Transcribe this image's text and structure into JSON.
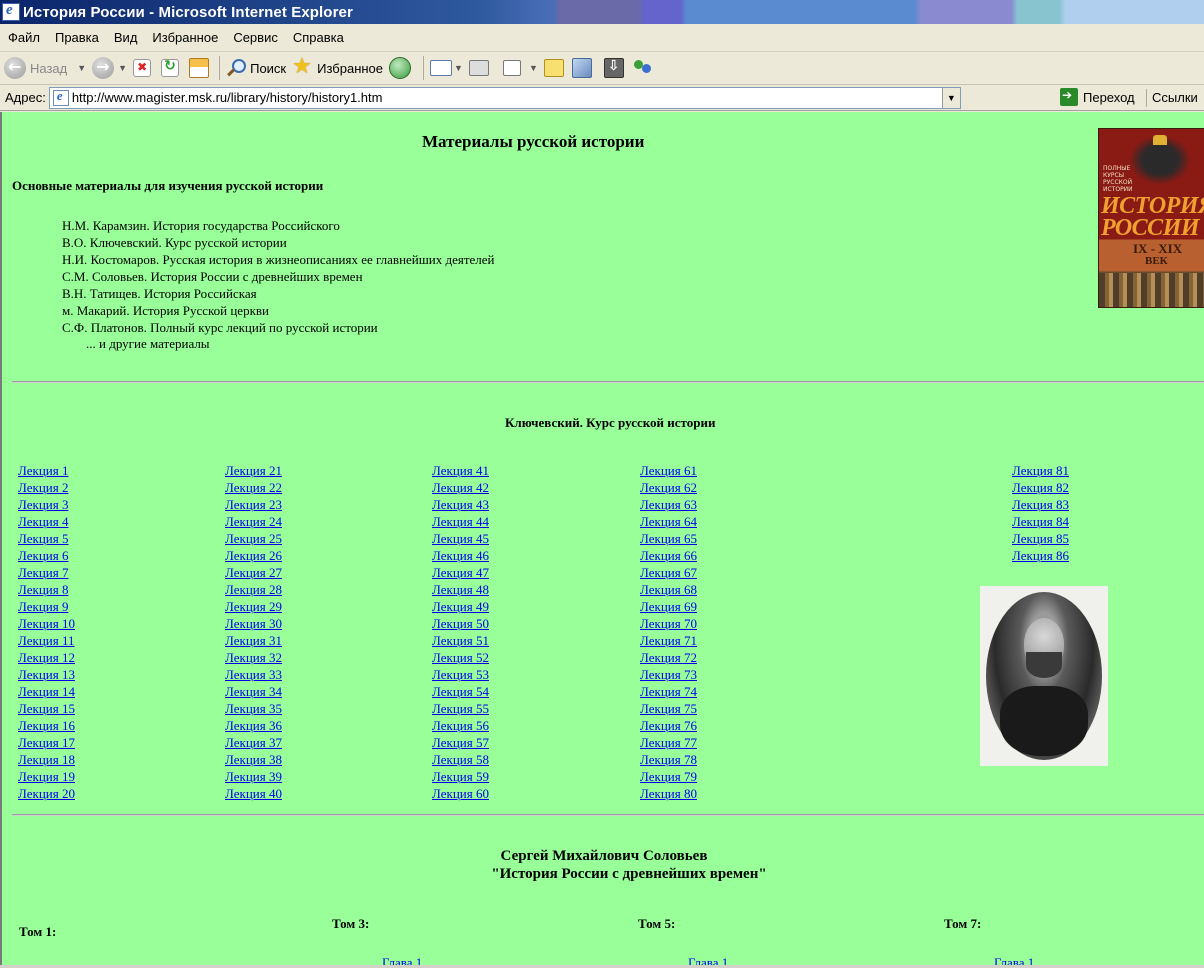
{
  "window": {
    "title": "История России - Microsoft Internet Explorer"
  },
  "menu": [
    "Файл",
    "Правка",
    "Вид",
    "Избранное",
    "Сервис",
    "Справка"
  ],
  "toolbar": {
    "back_label": "Назад",
    "search_label": "Поиск",
    "favorites_label": "Избранное"
  },
  "address": {
    "label": "Адрес:",
    "url": "http://www.magister.msk.ru/library/history/history1.htm",
    "go_label": "Переход",
    "links_label": "Ссылки"
  },
  "page": {
    "title": "Материалы русской истории",
    "subtitle": "Основные материалы для изучения русской истории",
    "materials": [
      "Н.М. Карамзин. История государства Российского",
      "В.О. Ключевский. Курс русской истории",
      "Н.И. Костомаров. Русская история в жизнеописаниях ее главнейших деятелей",
      "С.М. Соловьев. История России с древнейших времен",
      "В.Н. Татищев. История Российская",
      "м. Макарий. История Русской церкви",
      "С.Ф. Платонов. Полный курс лекций по русской истории"
    ],
    "more": "... и другие материалы",
    "book_cover": {
      "small_text": "ПОЛНЫЕ КУРСЫ РУССКОЙ ИСТОРИИ",
      "title": "ИСТОРИЯ РОССИИ",
      "centuries": "IX - XIX",
      "vek": "ВЕК"
    },
    "klyuchevsky": {
      "title": "Ключевский. Курс русской истории",
      "lectures": {
        "col1": [
          "Лекция 1",
          "Лекция 2",
          "Лекция 3",
          "Лекция 4",
          "Лекция 5",
          "Лекция 6",
          "Лекция 7",
          "Лекция 8",
          "Лекция 9",
          "Лекция 10",
          "Лекция 11",
          "Лекция 12",
          "Лекция 13",
          "Лекция 14",
          "Лекция 15",
          "Лекция 16",
          "Лекция 17",
          "Лекция 18",
          "Лекция 19",
          "Лекция 20"
        ],
        "col2": [
          "Лекция 21",
          "Лекция 22",
          "Лекция 23",
          "Лекция 24",
          "Лекция 25",
          "Лекция 26",
          "Лекция 27",
          "Лекция 28",
          "Лекция 29",
          "Лекция 30",
          "Лекция 31",
          "Лекция 32",
          "Лекция 33",
          "Лекция 34",
          "Лекция 35",
          "Лекция 36",
          "Лекция 37",
          "Лекция 38",
          "Лекция 39",
          "Лекция 40"
        ],
        "col3": [
          "Лекция 41",
          "Лекция 42",
          "Лекция 43",
          "Лекция 44",
          "Лекция 45",
          "Лекция 46",
          "Лекция 47",
          "Лекция 48",
          "Лекция 49",
          "Лекция 50",
          "Лекция 51",
          "Лекция 52",
          "Лекция 53",
          "Лекция 54",
          "Лекция 55",
          "Лекция 56",
          "Лекция 57",
          "Лекция 58",
          "Лекция 59",
          "Лекция 60"
        ],
        "col4": [
          "Лекция 61",
          "Лекция 62",
          "Лекция 63",
          "Лекция 64",
          "Лекция 65",
          "Лекция 66",
          "Лекция 67",
          "Лекция 68",
          "Лекция 69",
          "Лекция 70",
          "Лекция 71",
          "Лекция 72",
          "Лекция 73",
          "Лекция 74",
          "Лекция 75",
          "Лекция 76",
          "Лекция 77",
          "Лекция 78",
          "Лекция 79",
          "Лекция 80"
        ],
        "col5": [
          "Лекция 81",
          "Лекция 82",
          "Лекция 83",
          "Лекция 84",
          "Лекция 85",
          "Лекция 86"
        ]
      }
    },
    "solovyov": {
      "name": "Сергей Михайлович Соловьев",
      "work": "\"История России с древнейших времен\"",
      "toms": [
        "Том 1:",
        "Том 3:",
        "Том 5:",
        "Том 7:"
      ],
      "chapter_link": "Глава 1"
    }
  }
}
